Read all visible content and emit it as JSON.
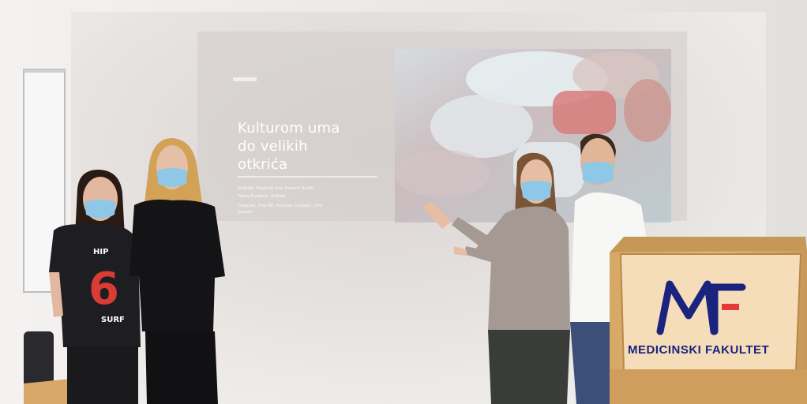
{
  "slide": {
    "title_lines": [
      "Kulturom uma",
      "do velikih",
      "otkrića"
    ],
    "subtitle_lines": [
      "Voditelji: Dragović Ana, Kovačić Đurđić",
      "Tijana Đurđević, Božidaj",
      "Dragović, Irma Bić, Kaćuras, Lucijašić, Vrid",
      "Kovačić"
    ]
  },
  "podium": {
    "logo": "MF",
    "caption": "MEDICINSKI FAKULTET"
  },
  "shirt": {
    "letters": "HIP",
    "number": "6",
    "tag": "SURF"
  },
  "colors": {
    "wall": "#ebe8e6",
    "projection": "#e8e5e4",
    "podium_wood": "#d9b27c",
    "podium_panel": "#f6e2c0",
    "logo_blue": "#1a237e",
    "logo_red": "#e53935",
    "mask_blue": "#8fc8e6"
  }
}
